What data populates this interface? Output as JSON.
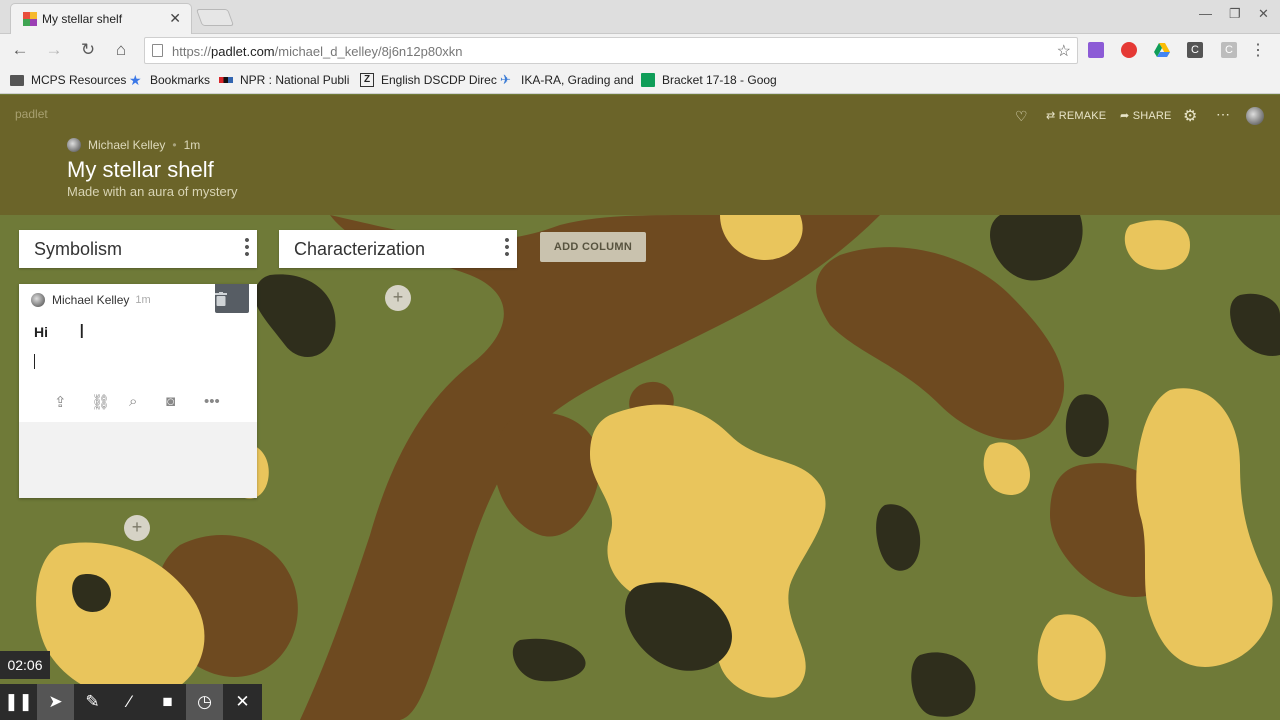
{
  "browser": {
    "tab_title": "My stellar shelf",
    "url_prefix": "https://",
    "url_host": "padlet.com",
    "url_path": "/michael_d_kelley/8j6n12p80xkn",
    "bookmarks": [
      {
        "label": "MCPS Resources",
        "icon": "folder-icon"
      },
      {
        "label": "Bookmarks",
        "icon": "star-icon"
      },
      {
        "label": "NPR : National Publi",
        "icon": "npr-icon"
      },
      {
        "label": "English DSCDP Direc",
        "icon": "z-icon"
      },
      {
        "label": "IKA-RA, Grading and",
        "icon": "plane-icon"
      },
      {
        "label": "Bracket 17-18 - Goog",
        "icon": "sheets-icon"
      }
    ]
  },
  "padlet": {
    "brand": "padlet",
    "actions": {
      "remake": "REMAKE",
      "share": "SHARE"
    },
    "author": "Michael Kelley",
    "age": "1m",
    "title": "My stellar shelf",
    "subtitle": "Made with an aura of mystery"
  },
  "board": {
    "columns": [
      {
        "title": "Symbolism"
      },
      {
        "title": "Characterization"
      }
    ],
    "add_column_label": "ADD COLUMN",
    "post": {
      "author": "Michael Kelley",
      "age": "1m",
      "text": "Hi"
    }
  },
  "recorder": {
    "elapsed": "02:06"
  },
  "colors": {
    "header_bg": "#6b6429",
    "camo_base": "#6f7a38",
    "camo_brown": "#6e4a20",
    "camo_yellow": "#e9c55c",
    "camo_dark": "#2f2e1c"
  }
}
